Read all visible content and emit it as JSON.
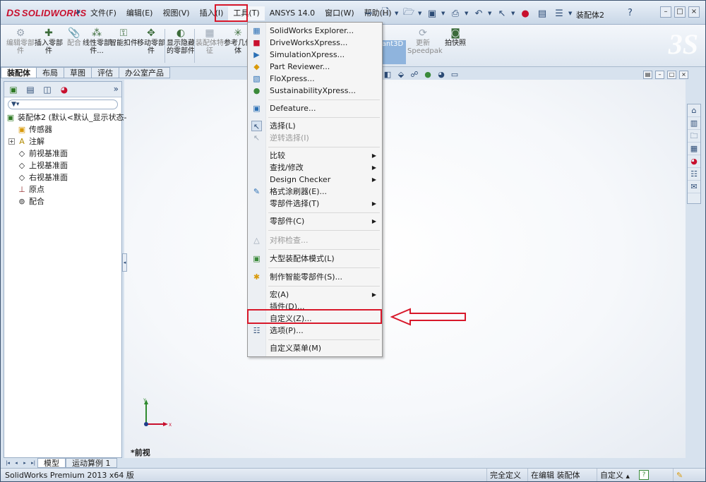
{
  "app": {
    "logo_prefix": "DS",
    "logo_text": "SOLIDWORKS",
    "document_title": "装配体2",
    "help_glyph": "?",
    "minimize_glyph": "–",
    "restore_glyph": "□",
    "close_glyph": "×"
  },
  "menubar": [
    {
      "label": "文件(F)"
    },
    {
      "label": "编辑(E)"
    },
    {
      "label": "视图(V)"
    },
    {
      "label": "插入(I)"
    },
    {
      "label": "工具(T)"
    },
    {
      "label": "ANSYS 14.0"
    },
    {
      "label": "窗口(W)"
    },
    {
      "label": "帮助(H)"
    }
  ],
  "command_manager": [
    {
      "label": "编辑零部件",
      "icon": "edit-component-icon"
    },
    {
      "label": "插入零部件",
      "icon": "insert-component-icon"
    },
    {
      "label": "配合",
      "icon": "mate-icon"
    },
    {
      "label": "线性零部件...",
      "icon": "linear-pattern-icon"
    },
    {
      "label": "智能扣件",
      "icon": "smart-fastener-icon"
    },
    {
      "label": "移动零部件",
      "icon": "move-component-icon"
    },
    {
      "label": "显示隐藏的零部件",
      "icon": "show-hidden-icon"
    },
    {
      "label": "装配体特征",
      "icon": "assembly-feature-icon"
    },
    {
      "label": "参考几何体",
      "icon": "reference-geometry-icon"
    },
    {
      "label": "tant3D",
      "icon": "instant3d-icon"
    },
    {
      "label": "更新Speedpak",
      "icon": "speedpak-icon"
    },
    {
      "label": "拍快照",
      "icon": "snapshot-icon"
    }
  ],
  "tabs": [
    {
      "label": "装配体"
    },
    {
      "label": "布局"
    },
    {
      "label": "草图"
    },
    {
      "label": "评估"
    },
    {
      "label": "办公室产品"
    }
  ],
  "feature_tree": {
    "root": "装配体2  (默认<默认_显示状态-",
    "items": [
      {
        "label": "传感器",
        "icon": "sensor-icon"
      },
      {
        "label": "注解",
        "icon": "annotation-icon"
      },
      {
        "label": "前视基准面",
        "icon": "plane-icon"
      },
      {
        "label": "上视基准面",
        "icon": "plane-icon"
      },
      {
        "label": "右视基准面",
        "icon": "plane-icon"
      },
      {
        "label": "原点",
        "icon": "origin-icon"
      },
      {
        "label": "配合",
        "icon": "mates-folder-icon"
      }
    ]
  },
  "tools_menu": {
    "items": [
      {
        "label": "SolidWorks Explorer...",
        "icon": "explorer-icon",
        "icon_color": "#2a6fb5"
      },
      {
        "label": "DriveWorksXpress...",
        "icon": "driveworks-icon",
        "icon_color": "#c8102e"
      },
      {
        "label": "SimulationXpress...",
        "icon": "simulation-icon",
        "icon_color": "#2a6fb5"
      },
      {
        "label": "Part Reviewer...",
        "icon": "part-reviewer-icon",
        "icon_color": "#d99a0b"
      },
      {
        "label": "FloXpress...",
        "icon": "floxpress-icon",
        "icon_color": "#2a6fb5"
      },
      {
        "label": "SustainabilityXpress...",
        "icon": "sustainability-icon",
        "icon_color": "#3a8a3a"
      },
      {
        "label": "Defeature...",
        "icon": "defeature-icon",
        "icon_color": "#2a6fb5"
      },
      {
        "label": "选择(L)",
        "icon": "select-cursor-icon",
        "icon_color": "#2c4b75"
      },
      {
        "label": "逆转选择(I)",
        "icon": "invert-selection-icon",
        "icon_color": "#9aa5b3"
      },
      {
        "label": "比较",
        "submenu": "▶"
      },
      {
        "label": "查找/修改",
        "submenu": "▶"
      },
      {
        "label": "Design Checker",
        "submenu": "▶"
      },
      {
        "label": "格式涂刷器(E)...",
        "icon": "format-painter-icon",
        "icon_color": "#2a6fb5"
      },
      {
        "label": "零部件选择(T)",
        "submenu": "▶"
      },
      {
        "label": "零部件(C)",
        "submenu": "▶"
      },
      {
        "label": "对称检查...",
        "icon": "symmetry-check-icon",
        "icon_color": "#9aa5b3"
      },
      {
        "label": "大型装配体模式(L)",
        "icon": "large-assembly-icon",
        "icon_color": "#3a8a3a"
      },
      {
        "label": "制作智能零部件(S)...",
        "icon": "smart-component-icon",
        "icon_color": "#d99a0b"
      },
      {
        "label": "宏(A)",
        "submenu": "▶"
      },
      {
        "label": "插件(D)..."
      },
      {
        "label": "自定义(Z)..."
      },
      {
        "label": "选项(P)...",
        "icon": "options-icon",
        "icon_color": "#2c4b75"
      },
      {
        "label": "自定义菜单(M)"
      }
    ]
  },
  "graphics": {
    "view_label": "*前视",
    "triad_x": "X",
    "triad_y": "Y"
  },
  "bottom_tabs": [
    {
      "label": "模型"
    },
    {
      "label": "运动算例 1"
    }
  ],
  "status_bar": {
    "product": "SolidWorks Premium 2013 x64 版",
    "defined": "完全定义",
    "editing": "在编辑 装配体",
    "custom": "自定义",
    "custom_caret": "▲",
    "help": "?"
  },
  "colors": {
    "highlight_red": "#d8182a",
    "brand_red": "#c8102e"
  }
}
